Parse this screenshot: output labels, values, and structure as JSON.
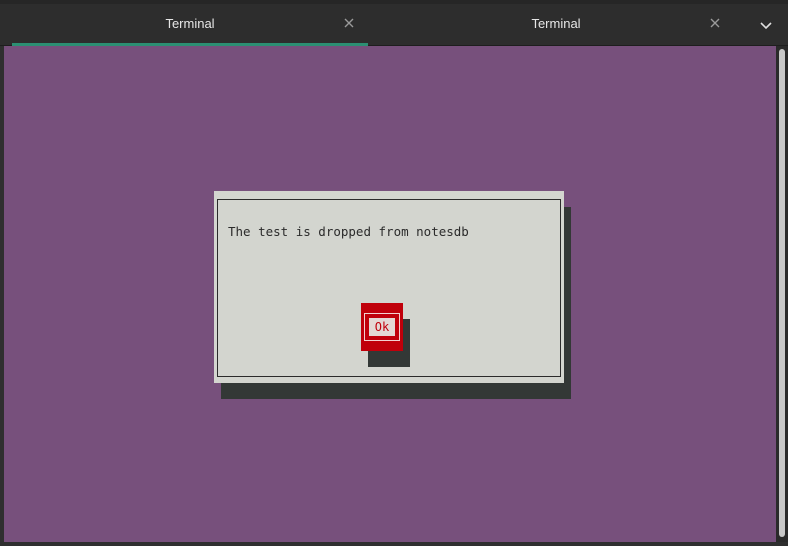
{
  "tabs": [
    {
      "label": "Terminal",
      "active": true
    },
    {
      "label": "Terminal",
      "active": false
    }
  ],
  "icons": {
    "tab_close": "close-icon",
    "tabs_menu": "chevron-down-icon"
  },
  "terminal": {
    "background_color": "#77507c"
  },
  "dialog": {
    "message": "The test is dropped from notesdb",
    "ok_button_label": "Ok",
    "background_color": "#d3d5cf",
    "button_color": "#c0000b"
  },
  "colors": {
    "active_tab_indicator": "#2c8f73"
  }
}
